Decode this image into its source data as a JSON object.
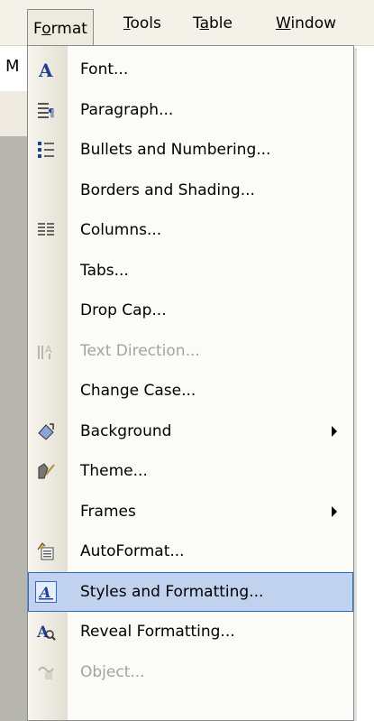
{
  "menubar": {
    "items": [
      {
        "label": "Format",
        "mnemonic_index": 1
      },
      {
        "label": "Tools",
        "mnemonic_index": 0
      },
      {
        "label": "Table",
        "mnemonic_index": 1
      },
      {
        "label": "Window",
        "mnemonic_index": 0
      }
    ]
  },
  "background": {
    "left_letter": "M"
  },
  "menu": {
    "items": [
      {
        "label": "Font...",
        "icon": "font-icon",
        "enabled": true,
        "submenu": false
      },
      {
        "label": "Paragraph...",
        "icon": "paragraph-icon",
        "enabled": true,
        "submenu": false
      },
      {
        "label": "Bullets and Numbering...",
        "icon": "bullets-icon",
        "enabled": true,
        "submenu": false
      },
      {
        "label": "Borders and Shading...",
        "icon": "",
        "enabled": true,
        "submenu": false
      },
      {
        "label": "Columns...",
        "icon": "columns-icon",
        "enabled": true,
        "submenu": false
      },
      {
        "label": "Tabs...",
        "icon": "",
        "enabled": true,
        "submenu": false
      },
      {
        "label": "Drop Cap...",
        "icon": "",
        "enabled": true,
        "submenu": false
      },
      {
        "label": "Text Direction...",
        "icon": "text-direction-icon",
        "enabled": false,
        "submenu": false
      },
      {
        "label": "Change Case...",
        "icon": "",
        "enabled": true,
        "submenu": false
      },
      {
        "label": "Background",
        "icon": "background-icon",
        "enabled": true,
        "submenu": true
      },
      {
        "label": "Theme...",
        "icon": "theme-icon",
        "enabled": true,
        "submenu": false
      },
      {
        "label": "Frames",
        "icon": "",
        "enabled": true,
        "submenu": true
      },
      {
        "label": "AutoFormat...",
        "icon": "autoformat-icon",
        "enabled": true,
        "submenu": false
      },
      {
        "label": "Styles and Formatting...",
        "icon": "styles-icon",
        "enabled": true,
        "submenu": false,
        "highlighted": true
      },
      {
        "label": "Reveal Formatting...",
        "icon": "reveal-formatting-icon",
        "enabled": true,
        "submenu": false
      },
      {
        "label": "Object...",
        "icon": "object-icon",
        "enabled": false,
        "submenu": false
      }
    ]
  },
  "colors": {
    "menubar_bg": "#f4f1e8",
    "highlight_bg": "#c1d2ee",
    "highlight_border": "#316ac5",
    "disabled_text": "#a6a39a"
  }
}
